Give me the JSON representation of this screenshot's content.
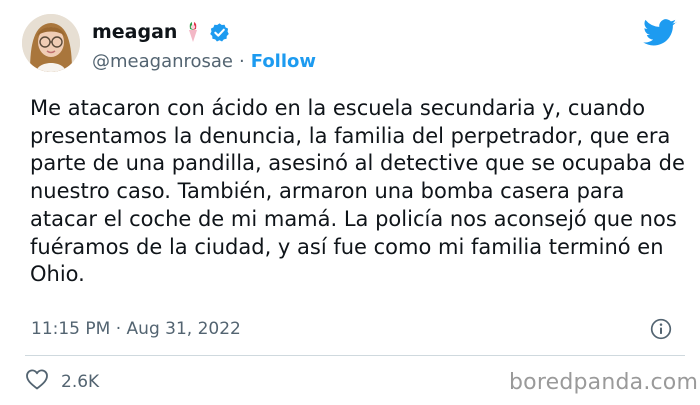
{
  "author": {
    "display_name": "meagan",
    "handle": "@meaganrosae",
    "separator": "·",
    "follow_label": "Follow"
  },
  "tweet": {
    "text": "Me atacaron con ácido en la escuela secundaria y, cuando presentamos la denuncia, la familia del perpetrador, que era parte de una pandilla, asesinó al detective que se ocupaba de nuestro caso. También, armaron una bomba casera para atacar el coche de mi mamá. La policía nos aconsejó que nos fuéramos de la ciudad, y así fue como mi familia terminó en Ohio.",
    "time": "11:15 PM",
    "separator": "·",
    "date": "Aug 31, 2022",
    "likes": "2.6K"
  },
  "watermark": "boredpanda.com",
  "icons": {
    "emoji": "bouquet-emoji-icon",
    "verified": "verified-badge-icon",
    "brand": "twitter-bird-icon",
    "info": "info-icon",
    "like": "heart-icon"
  },
  "colors": {
    "accent": "#1d9bf0",
    "text": "#0f1419",
    "muted": "#536471",
    "divider": "#cfd9de",
    "watermark": "#9a9a9a"
  }
}
